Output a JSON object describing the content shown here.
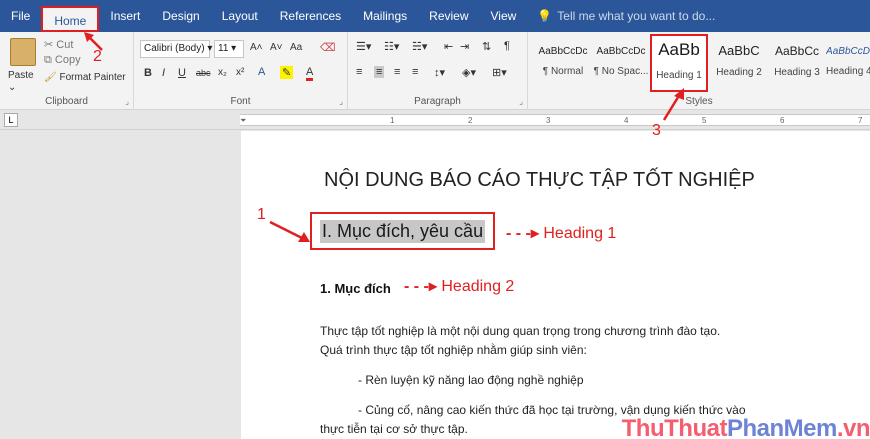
{
  "menu": {
    "tabs": [
      "File",
      "Home",
      "Insert",
      "Design",
      "Layout",
      "References",
      "Mailings",
      "Review",
      "View"
    ],
    "tell_me": "Tell me what you want to do..."
  },
  "clipboard": {
    "paste": "Paste",
    "cut": "Cut",
    "copy": "Copy",
    "format_painter": "Format Painter",
    "label": "Clipboard"
  },
  "font": {
    "name": "Calibri (Body)",
    "size": "11",
    "label": "Font",
    "bold": "B",
    "italic": "I",
    "underline": "U",
    "strike": "abc",
    "sub": "x₂",
    "sup": "x²",
    "grow": "A˄",
    "shrink": "A˅",
    "case": "Aa",
    "clear": "A"
  },
  "paragraph": {
    "label": "Paragraph"
  },
  "styles": {
    "label": "Styles",
    "items": [
      {
        "preview": "AaBbCcDc",
        "name": "¶ Normal"
      },
      {
        "preview": "AaBbCcDc",
        "name": "¶ No Spac..."
      },
      {
        "preview": "AaBb",
        "name": "Heading 1"
      },
      {
        "preview": "AaBbC",
        "name": "Heading 2"
      },
      {
        "preview": "AaBbCc",
        "name": "Heading 3"
      },
      {
        "preview": "AaBbCcD",
        "name": "Heading 4"
      }
    ]
  },
  "ruler": {
    "ticks": [
      "1",
      "2",
      "3",
      "4",
      "5",
      "6",
      "7"
    ]
  },
  "document": {
    "title": "NỘI DUNG BÁO CÁO THỰC TẬP TỐT NGHIỆP",
    "heading1": "I. Mục đích, yêu cầu",
    "heading2": "1. Mục đích",
    "para1": "Thực tập tốt nghiệp là một nội dung quan trọng trong chương trình đào tạo.",
    "para2": "Quá trình thực tập tốt nghiệp nhằm giúp sinh viên:",
    "bullet1": "- Rèn luyện kỹ năng lao động nghề nghiệp",
    "bullet2": "- Củng cố, nâng cao kiến thức đã học tại trường, vận dụng kiến thức vào",
    "para3": "thực tiễn tại cơ sở thực tập."
  },
  "annotations": {
    "heading1": "Heading 1",
    "heading2": "Heading 2",
    "step1": "1",
    "step2": "2",
    "step3": "3"
  },
  "watermark": {
    "part1": "ThuThuat",
    "part2": "PhanMem",
    "part3": ".vn"
  },
  "colors": {
    "accent": "#2b579a",
    "annotation": "#e02020"
  }
}
